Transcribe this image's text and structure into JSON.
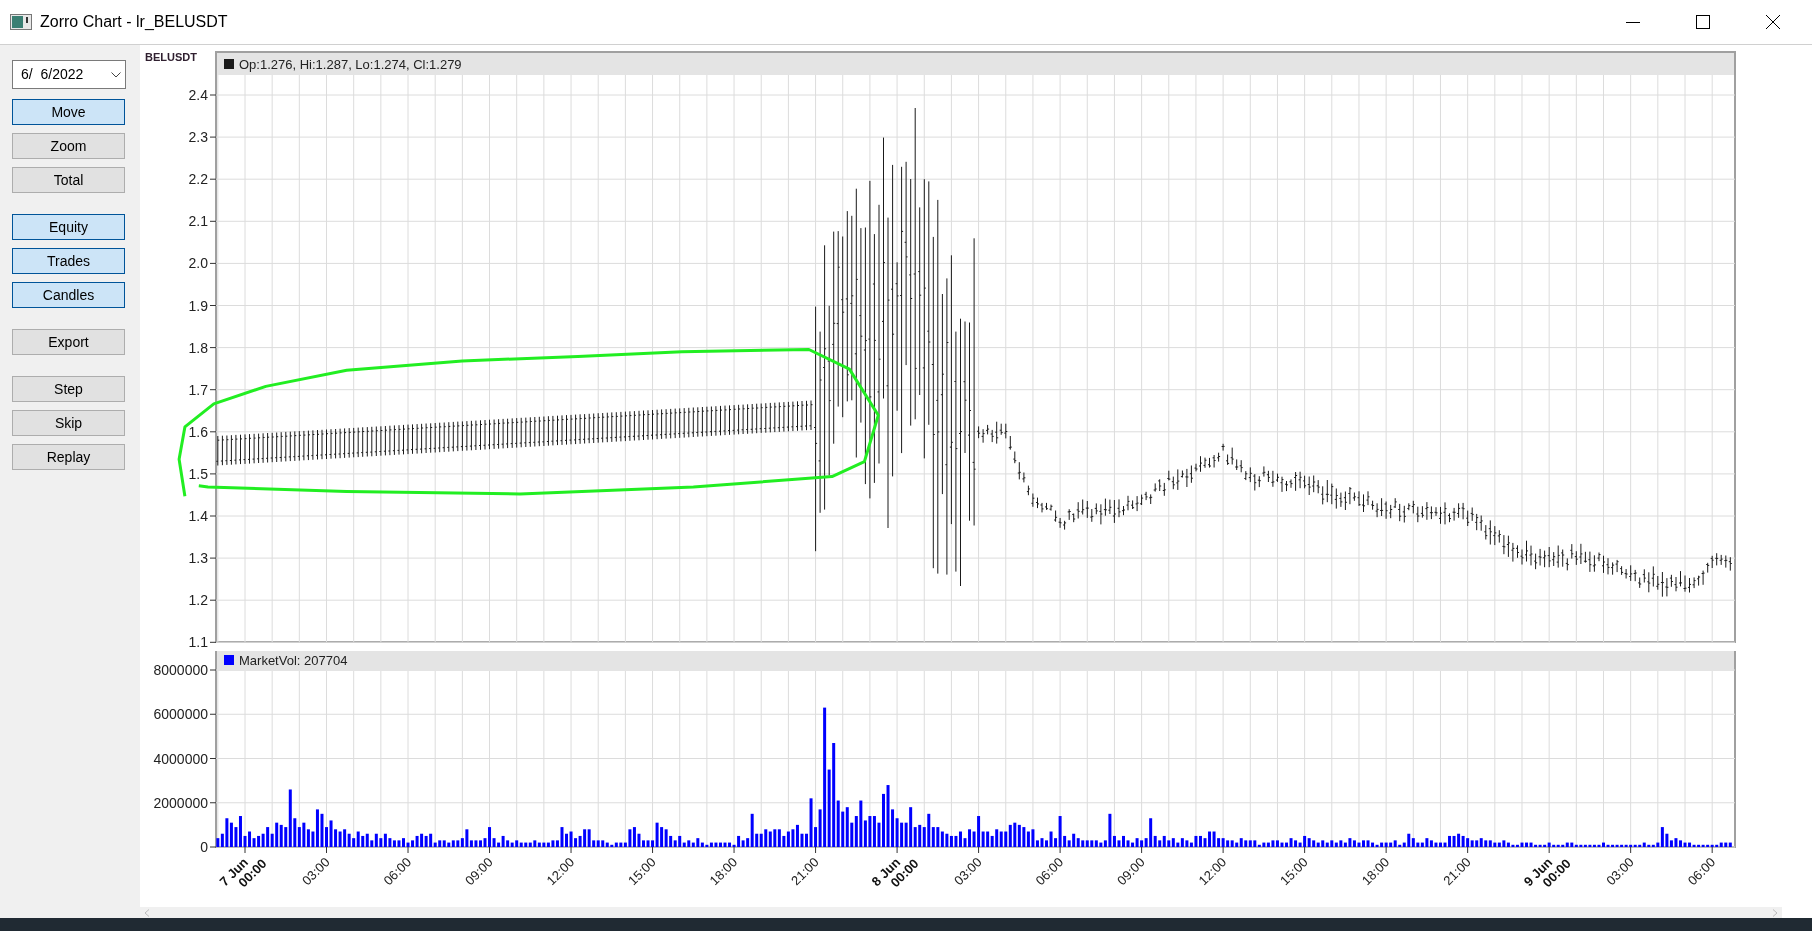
{
  "window": {
    "title": "Zorro Chart - lr_BELUSDT"
  },
  "date_picker": {
    "value": "6/  6/2022"
  },
  "button_groups": [
    [
      {
        "label": "Move",
        "selected": true
      },
      {
        "label": "Zoom",
        "selected": false
      },
      {
        "label": "Total",
        "selected": false
      }
    ],
    [
      {
        "label": "Equity",
        "selected": true
      },
      {
        "label": "Trades",
        "selected": true
      },
      {
        "label": "Candles",
        "selected": true
      }
    ],
    [
      {
        "label": "Export",
        "selected": false
      }
    ],
    [
      {
        "label": "Step",
        "selected": false
      },
      {
        "label": "Skip",
        "selected": false
      },
      {
        "label": "Replay",
        "selected": false
      }
    ]
  ],
  "chart": {
    "symbol": "BELUSDT",
    "price_panel": {
      "legend": "Op:1.276, Hi:1.287, Lo:1.274, Cl:1.279",
      "color": "#1a1a1a",
      "y_ticks": [
        "2.4",
        "2.3",
        "2.2",
        "2.1",
        "2.0",
        "1.9",
        "1.8",
        "1.7",
        "1.6",
        "1.5",
        "1.4",
        "1.3",
        "1.2",
        "1.1"
      ]
    },
    "volume_panel": {
      "legend": "MarketVol: 207704",
      "color": "#0000ff",
      "chart_data": {
        "type": "bar",
        "grid": true,
        "ylim": [
          0,
          8000000
        ],
        "yticks": [
          8000000,
          6000000,
          4000000,
          2000000,
          0
        ],
        "values": [
          400000,
          600000,
          1300000,
          1100000,
          900000,
          1400000,
          500000,
          700000,
          400000,
          500000,
          600000,
          900000,
          600000,
          1100000,
          1000000,
          900000,
          2600000,
          1300000,
          900000,
          1100000,
          800000,
          700000,
          1700000,
          1500000,
          900000,
          1200000,
          800000,
          700000,
          800000,
          600000,
          400000,
          700000,
          500000,
          600000,
          300000,
          600000,
          400000,
          600000,
          400000,
          300000,
          300000,
          400000,
          200000,
          300000,
          500000,
          600000,
          500000,
          600000,
          200000,
          300000,
          300000,
          200000,
          300000,
          300000,
          400000,
          800000,
          300000,
          300000,
          300000,
          400000,
          900000,
          400000,
          200000,
          500000,
          300000,
          200000,
          300000,
          200000,
          200000,
          200000,
          300000,
          200000,
          200000,
          200000,
          300000,
          300000,
          900000,
          600000,
          700000,
          400000,
          500000,
          800000,
          800000,
          300000,
          300000,
          300000,
          200000,
          100000,
          200000,
          200000,
          200000,
          800000,
          900000,
          600000,
          300000,
          300000,
          300000,
          1100000,
          900000,
          800000,
          500000,
          300000,
          500000,
          200000,
          300000,
          200000,
          400000,
          200000,
          100000,
          200000,
          200000,
          200000,
          200000,
          200000,
          100000,
          500000,
          300000,
          400000,
          1500000,
          600000,
          600000,
          800000,
          700000,
          800000,
          800000,
          500000,
          700000,
          800000,
          1000000,
          600000,
          600000,
          2200000,
          900000,
          1700000,
          6300000,
          3500000,
          4700000,
          2100000,
          1600000,
          1800000,
          1100000,
          1400000,
          2100000,
          1200000,
          1400000,
          1400000,
          1100000,
          2400000,
          2800000,
          1700000,
          1300000,
          1100000,
          1100000,
          1800000,
          900000,
          1000000,
          900000,
          1500000,
          900000,
          900000,
          700000,
          600000,
          500000,
          500000,
          700000,
          400000,
          800000,
          700000,
          1400000,
          700000,
          700000,
          500000,
          800000,
          700000,
          700000,
          1000000,
          1100000,
          1000000,
          900000,
          700000,
          800000,
          300000,
          400000,
          300000,
          700000,
          400000,
          1400000,
          500000,
          300000,
          600000,
          400000,
          300000,
          300000,
          300000,
          300000,
          200000,
          300000,
          1500000,
          500000,
          300000,
          500000,
          300000,
          200000,
          400000,
          300000,
          400000,
          1300000,
          500000,
          300000,
          500000,
          300000,
          400000,
          200000,
          400000,
          300000,
          200000,
          500000,
          500000,
          400000,
          700000,
          700000,
          400000,
          400000,
          300000,
          300000,
          200000,
          400000,
          300000,
          300000,
          300000,
          100000,
          200000,
          200000,
          300000,
          300000,
          200000,
          200000,
          400000,
          300000,
          200000,
          500000,
          400000,
          300000,
          200000,
          300000,
          200000,
          300000,
          200000,
          300000,
          200000,
          400000,
          300000,
          200000,
          300000,
          300000,
          200000,
          100000,
          200000,
          200000,
          200000,
          300000,
          100000,
          200000,
          600000,
          400000,
          200000,
          200000,
          400000,
          300000,
          200000,
          200000,
          200000,
          500000,
          500000,
          600000,
          500000,
          400000,
          300000,
          300000,
          400000,
          300000,
          300000,
          200000,
          200000,
          300000,
          200000,
          100000,
          100000,
          200000,
          200000,
          200000,
          100000,
          100000,
          100000,
          200000,
          100000,
          100000,
          100000,
          200000,
          200000,
          100000,
          100000,
          100000,
          100000,
          100000,
          100000,
          200000,
          100000,
          100000,
          100000,
          100000,
          100000,
          100000,
          100000,
          100000,
          200000,
          100000,
          100000,
          200000,
          900000,
          600000,
          300000,
          400000,
          300000,
          200000,
          200000,
          100000,
          100000,
          100000,
          100000,
          100000,
          100000,
          200000,
          200000,
          200000
        ]
      }
    },
    "x_ticks": [
      {
        "day": "7 Jun",
        "time": "00:00"
      },
      {
        "time": "03:00"
      },
      {
        "time": "06:00"
      },
      {
        "time": "09:00"
      },
      {
        "time": "12:00"
      },
      {
        "time": "15:00"
      },
      {
        "time": "18:00"
      },
      {
        "time": "21:00"
      },
      {
        "day": "8 Jun",
        "time": "00:00"
      },
      {
        "time": "03:00"
      },
      {
        "time": "06:00"
      },
      {
        "time": "09:00"
      },
      {
        "time": "12:00"
      },
      {
        "time": "15:00"
      },
      {
        "time": "18:00"
      },
      {
        "time": "21:00"
      },
      {
        "day": "9 Jun",
        "time": "00:00"
      },
      {
        "time": "03:00"
      },
      {
        "time": "06:00"
      }
    ]
  }
}
